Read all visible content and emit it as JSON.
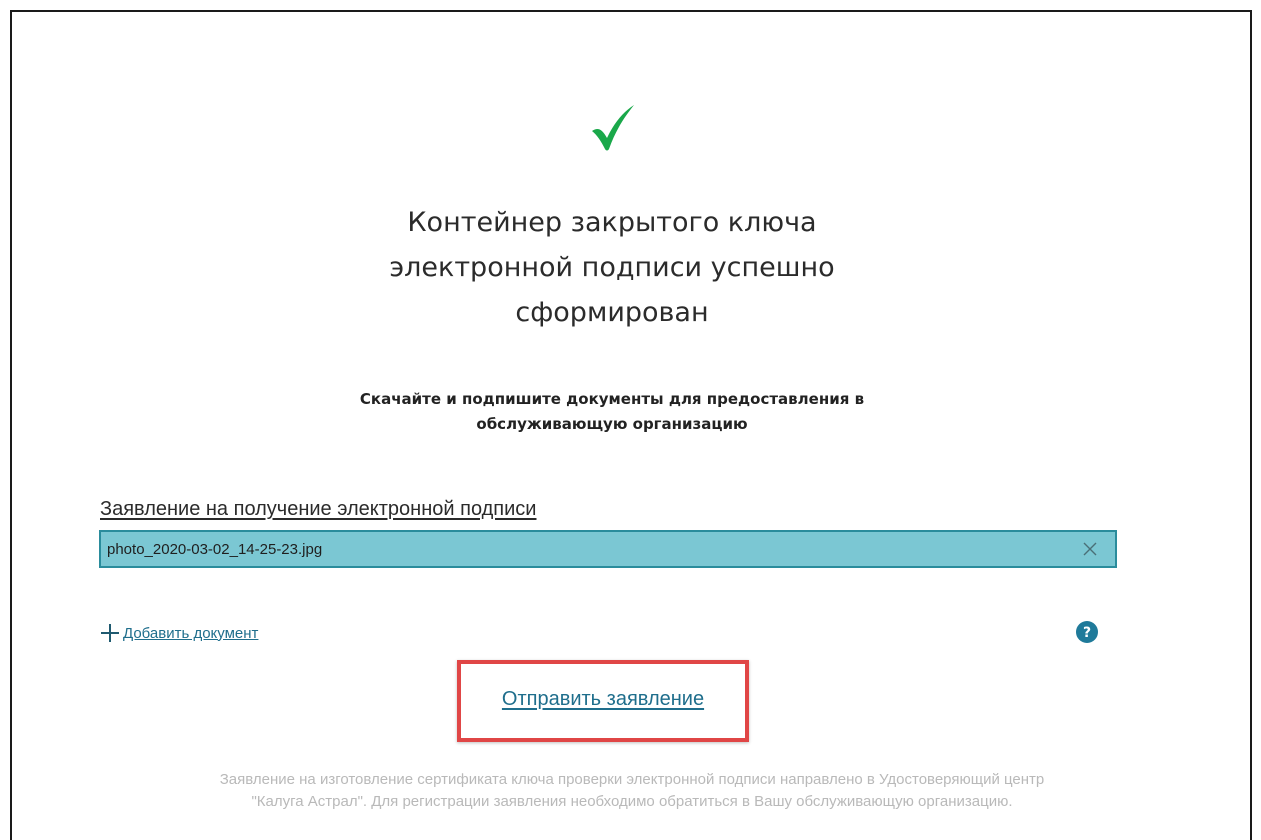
{
  "status": {
    "icon": "checkmark-icon",
    "color": "#1aa84a"
  },
  "title_lines": [
    "Контейнер закрытого ключа",
    "электронной подписи успешно",
    "сформирован"
  ],
  "subtitle_lines": [
    "Скачайте и подпишите документы для предоставления в",
    "обслуживающую организацию"
  ],
  "document": {
    "label": "Заявление на получение электронной подписи",
    "file_name": "photo_2020-03-02_14-25-23.jpg",
    "remove_icon": "close-icon"
  },
  "add_document": {
    "icon": "plus-icon",
    "label": "Добавить документ"
  },
  "help": {
    "icon": "question-icon",
    "label": "?"
  },
  "send_button": {
    "label": "Отправить заявление",
    "highlight_color": "#e04646"
  },
  "footer_lines": [
    "Заявление на изготовление сертификата ключа проверки электронной подписи направлено в Удостоверяющий центр",
    "\"Калуга Астрал\". Для регистрации заявления необходимо обратиться в Вашу обслуживающую организацию."
  ],
  "colors": {
    "accent": "#1f6e8c",
    "file_row_bg": "#7bc7d3",
    "file_row_border": "#2a8c9c",
    "success": "#1aa84a",
    "footer_text": "#b9b9b9"
  }
}
